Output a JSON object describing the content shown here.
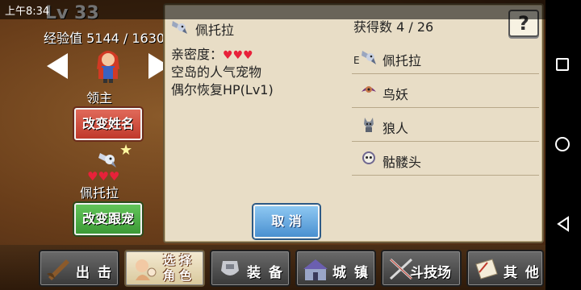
{
  "status": {
    "time": "上午8:34"
  },
  "player": {
    "level": "Lv 33",
    "exp": "经验值 5144 / 1630",
    "role": "领主",
    "rename_button": "改变姓名",
    "pet_hearts": "♥♥♥",
    "pet_name": "佩托拉",
    "change_pet_button": "改变跟宠"
  },
  "dialog": {
    "pet_title": "佩托拉",
    "affinity_label": "亲密度：",
    "affinity_hearts": "♥♥♥",
    "desc_line1": "空岛的人气宠物",
    "desc_line2": "偶尔恢复HP(Lv1)",
    "cancel_button": "取 消",
    "collected": "获得数 4 / 26",
    "help_button": "?",
    "equipped_marker": "E",
    "pets": [
      {
        "name": "佩托拉",
        "icon": "petra-icon"
      },
      {
        "name": "鸟妖",
        "icon": "harpy-icon"
      },
      {
        "name": "狼人",
        "icon": "werewolf-icon"
      },
      {
        "name": "骷髅头",
        "icon": "skull-icon"
      }
    ]
  },
  "nav": [
    {
      "label": "出 击",
      "icon": "attack-icon"
    },
    {
      "label": "选 择",
      "label2": "角 色",
      "icon": "select-character-icon"
    },
    {
      "label": "装 备",
      "icon": "equipment-icon"
    },
    {
      "label": "城 镇",
      "icon": "town-icon"
    },
    {
      "label": "斗技场",
      "icon": "arena-icon"
    },
    {
      "label": "其 他",
      "icon": "other-icon"
    }
  ],
  "colors": {
    "heart": "#e8213a",
    "dialog_bg": "#e8ddc6",
    "red_button": "#c0392b",
    "green_button": "#3c9a36",
    "blue_button": "#4a90d0"
  }
}
